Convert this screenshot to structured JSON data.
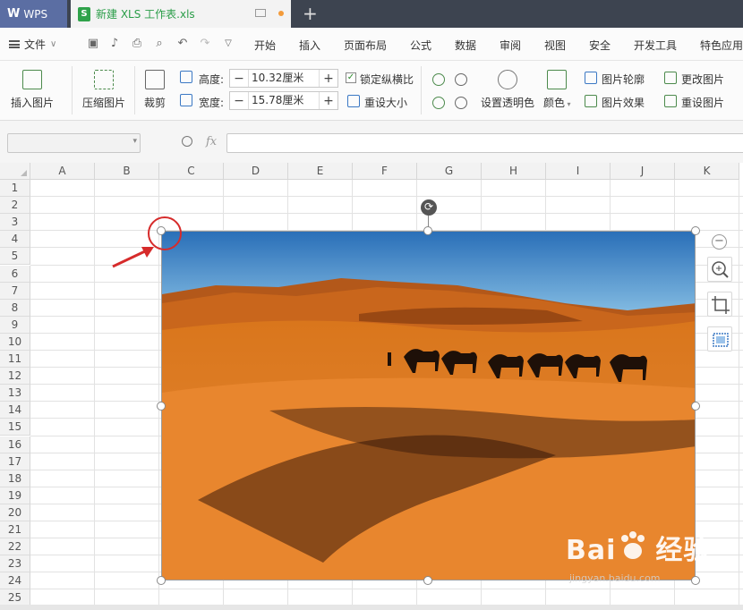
{
  "titlebar": {
    "app_label": "WPS",
    "doc_tab": "新建 XLS 工作表.xls"
  },
  "menubar": {
    "file_label": "文件",
    "tabs": [
      "开始",
      "插入",
      "页面布局",
      "公式",
      "数据",
      "审阅",
      "视图",
      "安全",
      "开发工具",
      "特色应用"
    ]
  },
  "ribbon": {
    "insert_picture": "插入图片",
    "compress_picture": "压缩图片",
    "crop": "裁剪",
    "height_label": "高度:",
    "height_value": "10.32厘米",
    "width_label": "宽度:",
    "width_value": "15.78厘米",
    "lock_aspect": "锁定纵横比",
    "reset_size": "重设大小",
    "set_transparent": "设置透明色",
    "color": "颜色",
    "picture_outline": "图片轮廓",
    "picture_effects": "图片效果",
    "change_picture": "更改图片",
    "reset_picture": "重设图片"
  },
  "formula": {
    "fx": "fx"
  },
  "grid": {
    "columns": [
      "A",
      "B",
      "C",
      "D",
      "E",
      "F",
      "G",
      "H",
      "I",
      "J",
      "K"
    ],
    "rows": [
      "1",
      "2",
      "3",
      "4",
      "5",
      "6",
      "7",
      "8",
      "9",
      "10",
      "11",
      "12",
      "13",
      "14",
      "15",
      "16",
      "17",
      "18",
      "19",
      "20",
      "21",
      "22",
      "23",
      "24",
      "25"
    ]
  },
  "watermark": {
    "brand": "Bai",
    "brand2": "经验",
    "sub": "jingyan.baidu.com"
  },
  "colors": {
    "accent_green": "#2a9d48",
    "annotation_red": "#d62b2b"
  }
}
